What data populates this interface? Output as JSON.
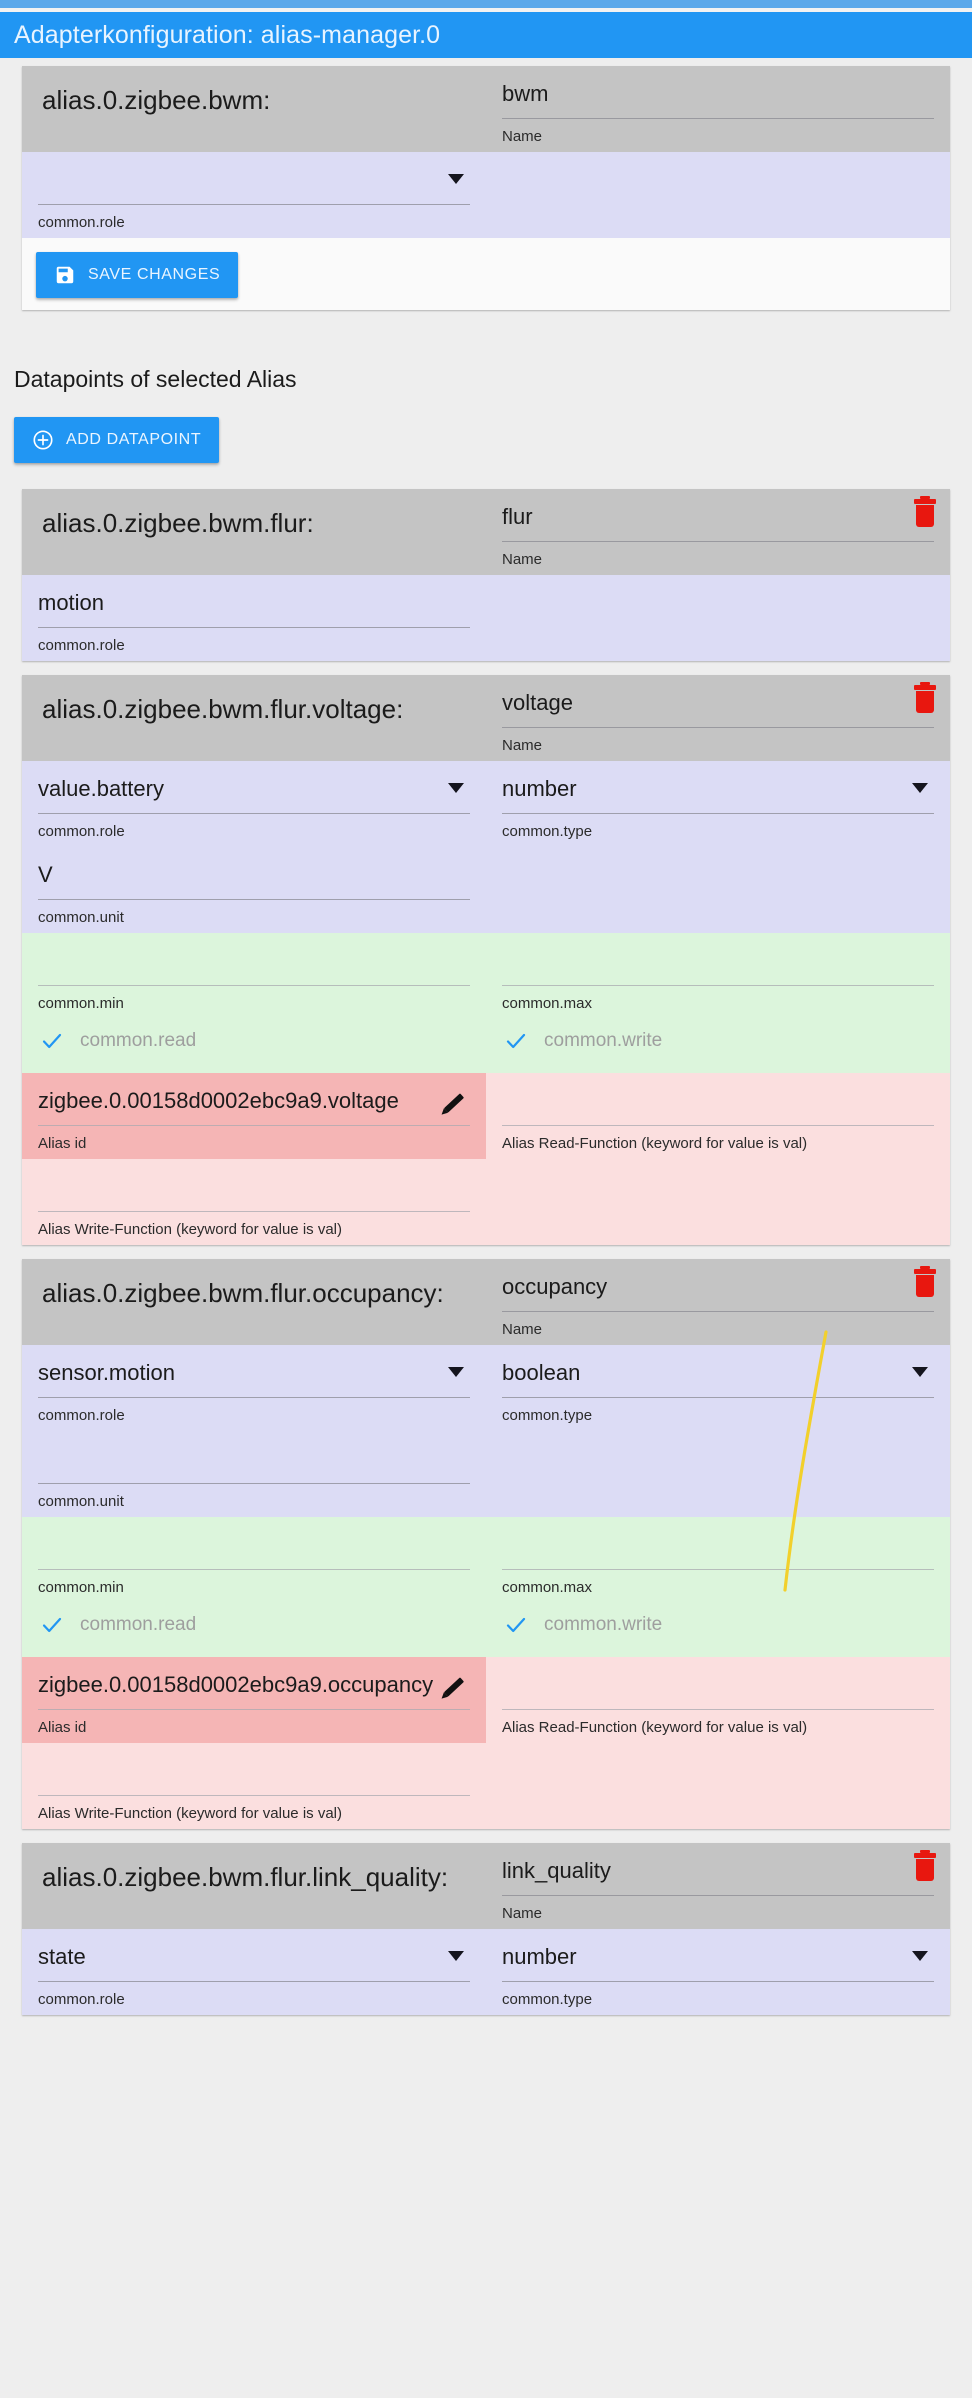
{
  "header": {
    "title": "Adapterkonfiguration: alias-manager.0"
  },
  "alias_card": {
    "path": "alias.0.zigbee.bwm:",
    "name_value": "bwm",
    "name_hint": "Name",
    "role_value": "",
    "role_hint": "common.role",
    "save_label": "SAVE CHANGES",
    "save_icon": "save-icon"
  },
  "datapoints_section": {
    "title": "Datapoints of selected Alias",
    "add_label": "ADD DATAPOINT",
    "add_icon": "plus-circle-icon"
  },
  "labels": {
    "name": "Name",
    "common_role": "common.role",
    "common_type": "common.type",
    "common_unit": "common.unit",
    "common_min": "common.min",
    "common_max": "common.max",
    "common_read": "common.read",
    "common_write": "common.write",
    "alias_id": "Alias id",
    "alias_read_fn": "Alias Read-Function (keyword for value is val)",
    "alias_write_fn": "Alias Write-Function (keyword for value is val)",
    "delete_icon": "trash-icon",
    "edit_icon": "pencil-icon",
    "check_icon": "check-icon",
    "dropdown_icon": "chevron-down-icon"
  },
  "datapoints": [
    {
      "path": "alias.0.zigbee.bwm.flur:",
      "name_value": "flur",
      "role_value": "motion",
      "role_is_select": false,
      "has_type": false,
      "has_unit": false,
      "has_minmax": false,
      "has_alias": false
    },
    {
      "path": "alias.0.zigbee.bwm.flur.voltage:",
      "name_value": "voltage",
      "role_value": "value.battery",
      "role_is_select": true,
      "has_type": true,
      "type_value": "number",
      "has_unit": true,
      "unit_value": "V",
      "has_minmax": true,
      "min_value": "",
      "max_value": "",
      "read_checked": true,
      "write_checked": true,
      "has_alias": true,
      "alias_id_value": "zigbee.0.00158d0002ebc9a9.voltage",
      "alias_read_value": "",
      "alias_write_value": ""
    },
    {
      "path": "alias.0.zigbee.bwm.flur.occupancy:",
      "name_value": "occupancy",
      "role_value": "sensor.motion",
      "role_is_select": true,
      "has_type": true,
      "type_value": "boolean",
      "has_unit": true,
      "unit_value": "",
      "has_minmax": true,
      "min_value": "",
      "max_value": "",
      "read_checked": true,
      "write_checked": true,
      "has_alias": true,
      "alias_id_value": "zigbee.0.00158d0002ebc9a9.occupancy",
      "alias_read_value": "",
      "alias_write_value": ""
    },
    {
      "path": "alias.0.zigbee.bwm.flur.link_quality:",
      "name_value": "link_quality",
      "role_value": "state",
      "role_is_select": true,
      "has_type": true,
      "type_value": "number",
      "has_unit": false,
      "has_minmax": false,
      "has_alias": false
    }
  ],
  "colors": {
    "accent": "#2196f3",
    "header_bar": "#2196f3",
    "top_strip": "#5ba8ea",
    "gray_band": "#c4c4c4",
    "lavender_band": "#dcdcf5",
    "green_band": "#dcf5dc",
    "pink_dark_band": "#f5b5b5",
    "pink_light_band": "#fbdfdf",
    "trash_red": "#e8170f",
    "check_blue": "#2196f3",
    "annotation_yellow": "#f2d02c"
  }
}
